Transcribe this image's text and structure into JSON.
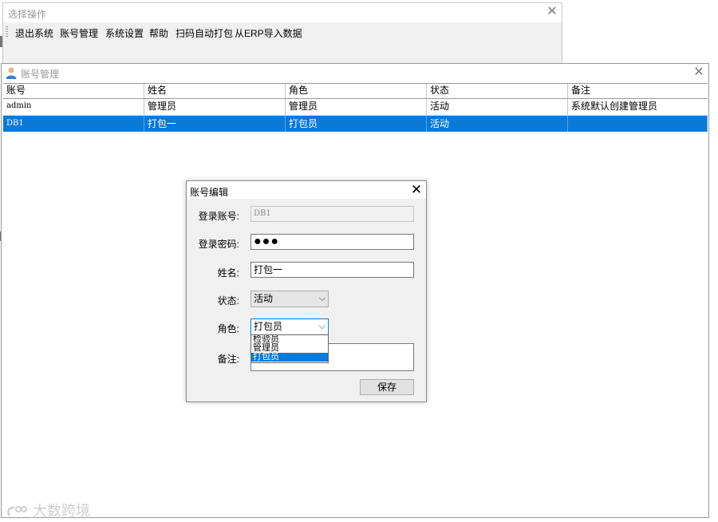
{
  "select_window": {
    "title": "选择操作",
    "menu": [
      "退出系统",
      "账号管理",
      "系统设置",
      "帮助",
      "扫码自动打包",
      "从ERP导入数据"
    ]
  },
  "account_window": {
    "title": "账号管理",
    "columns": [
      "账号",
      "姓名",
      "角色",
      "状态",
      "备注"
    ],
    "rows": [
      [
        "admin",
        "管理员",
        "管理员",
        "活动",
        "系统默认创建管理员"
      ],
      [
        "DB1",
        "打包一",
        "打包员",
        "活动",
        ""
      ]
    ]
  },
  "edit_dialog": {
    "title": "账号编辑",
    "labels": {
      "account": "登录账号:",
      "password": "登录密码:",
      "name": "姓名:",
      "status": "状态:",
      "role": "角色:",
      "remark": "备注:"
    },
    "values": {
      "account": "DB1",
      "password": "●●●",
      "name": "打包一",
      "status": "活动",
      "role": "打包员",
      "remark": ""
    },
    "role_options": [
      "检验员",
      "管理员",
      "打包员"
    ],
    "role_selected_index": 2,
    "save_label": "保存"
  },
  "watermark": "大数跨境",
  "colors": {
    "selection": "#0a79d7",
    "window_bg": "#f0f0f0"
  }
}
